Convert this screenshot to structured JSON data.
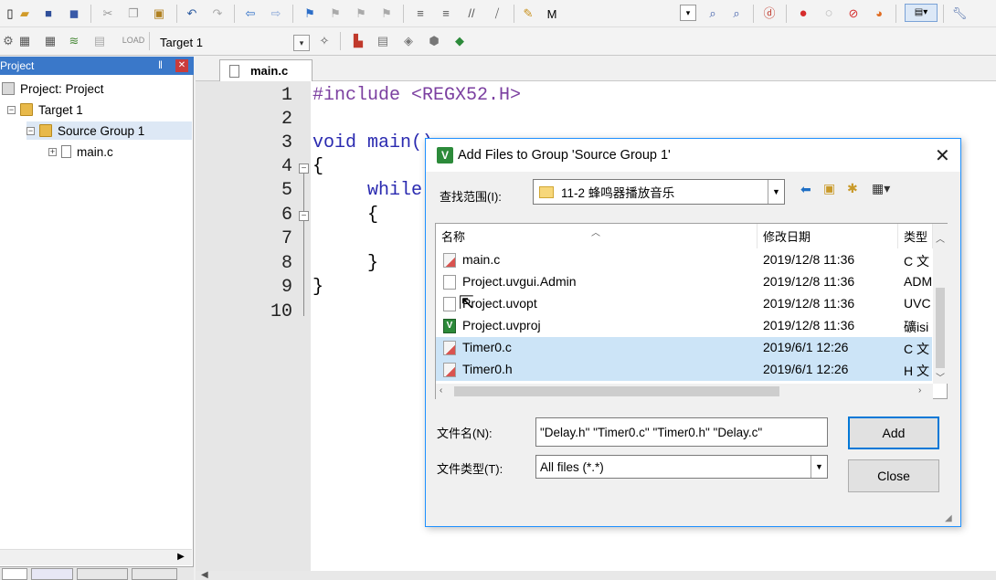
{
  "toolbar2": {
    "target": "Target 1"
  },
  "project_panel": {
    "title": "Project",
    "pin": "‖",
    "tree": [
      {
        "label": "Project: Project"
      },
      {
        "label": "Target 1"
      },
      {
        "label": "Source Group 1"
      },
      {
        "label": "main.c"
      }
    ]
  },
  "editor": {
    "tab": "main.c",
    "line_numbers": [
      "1",
      "2",
      "3",
      "4",
      "5",
      "6",
      "7",
      "8",
      "9",
      "10"
    ],
    "lines": {
      "l1": "#include <REGX52.H>",
      "l3": "void main()",
      "l4": "{",
      "l5": "while",
      "l6": "{",
      "l8": "}",
      "l9": "}"
    }
  },
  "dialog": {
    "title": "Add Files to Group 'Source Group 1'",
    "look_in_label": "查找范围(I):",
    "look_in_value": "11-2 蜂鸣器播放音乐",
    "columns": [
      "名称",
      "修改日期",
      "类型"
    ],
    "files": [
      {
        "name": "main.c",
        "date": "2019/12/8 11:36",
        "type": "C 文",
        "icon": "c-file-icon",
        "selected": false
      },
      {
        "name": "Project.uvgui.Admin",
        "date": "2019/12/8 11:36",
        "type": "ADM",
        "icon": "document-icon",
        "selected": false
      },
      {
        "name": "Project.uvopt",
        "date": "2019/12/8 11:36",
        "type": "UVC",
        "icon": "document-icon",
        "selected": false
      },
      {
        "name": "Project.uvproj",
        "date": "2019/12/8 11:36",
        "type": "礦isi",
        "icon": "uvision-project-icon",
        "selected": false
      },
      {
        "name": "Timer0.c",
        "date": "2019/6/1 12:26",
        "type": "C 文",
        "icon": "c-file-icon",
        "selected": true
      },
      {
        "name": "Timer0.h",
        "date": "2019/6/1 12:26",
        "type": "H 文",
        "icon": "c-file-icon",
        "selected": true
      }
    ],
    "filename_label": "文件名(N):",
    "filename_value": "\"Delay.h\" \"Timer0.c\" \"Timer0.h\" \"Delay.c\"",
    "filetype_label": "文件类型(T):",
    "filetype_value": "All files (*.*)",
    "add_button": "Add",
    "close_button": "Close"
  },
  "colors": {
    "accent": "#0078d7",
    "selection": "#cce4f7",
    "keyword": "#2a2ab0",
    "preprocessor": "#7b3fa0",
    "panel_header": "#3a78c9"
  }
}
